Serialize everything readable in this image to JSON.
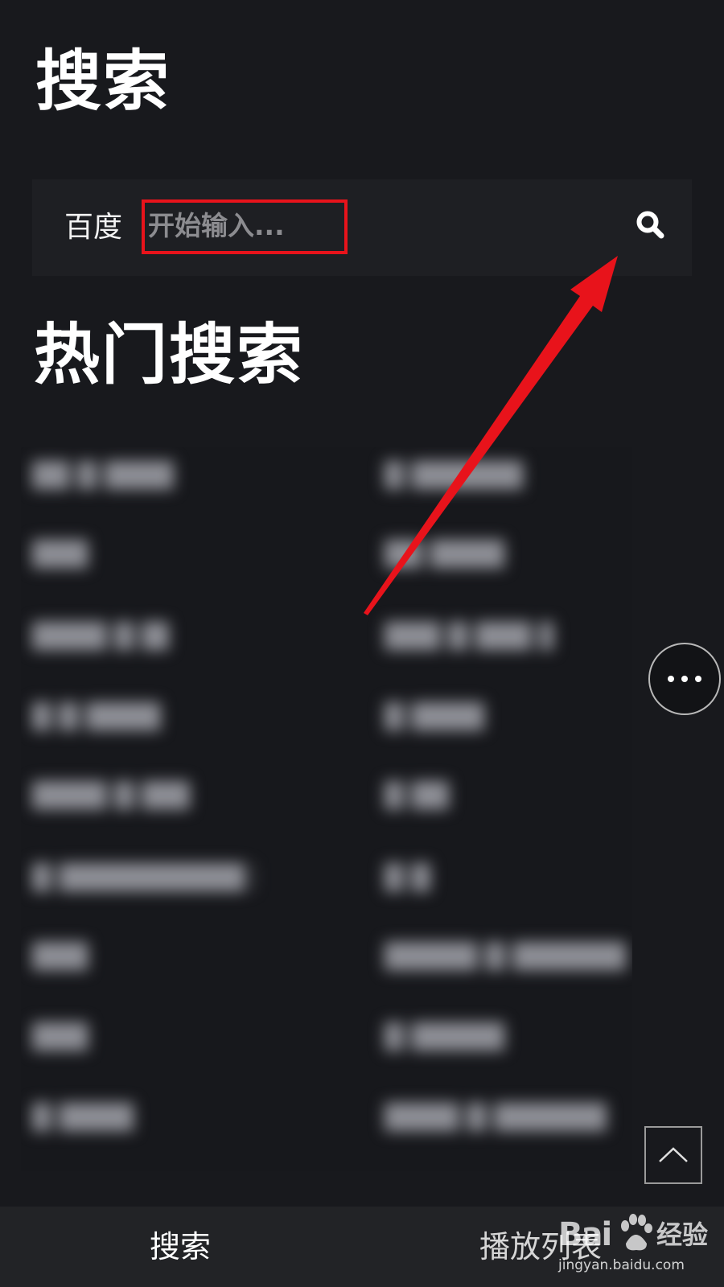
{
  "page": {
    "title": "搜索"
  },
  "search": {
    "engine": "百度",
    "placeholder": "开始输入...",
    "value": ""
  },
  "hot": {
    "title": "热门搜索",
    "items": [
      "██ █ ████",
      "█ ██████",
      "███",
      "██ ████",
      "████ █ ██",
      "███ █ ███ ██",
      "█ █ ████",
      "█ ████",
      "████ █ ███",
      "█ ██",
      "█ ██████████ ███",
      "█ █",
      "███",
      "█████ █ ████████",
      "███",
      "█ █████",
      "█ ████",
      "████ █ ████████"
    ]
  },
  "tabs": {
    "search": "搜索",
    "playlist": "播放列表"
  },
  "watermark": {
    "brand": "Bai",
    "product": "经验",
    "url": "jingyan.baidu.com"
  },
  "colors": {
    "background": "#18191d",
    "search_bar": "#1e1f23",
    "annotation": "#e8131b",
    "tab_bar": "#222326"
  },
  "icons": {
    "search_button": "search-icon",
    "more_button": "more-horizontal-icon",
    "back_to_top": "chevron-up-icon"
  }
}
